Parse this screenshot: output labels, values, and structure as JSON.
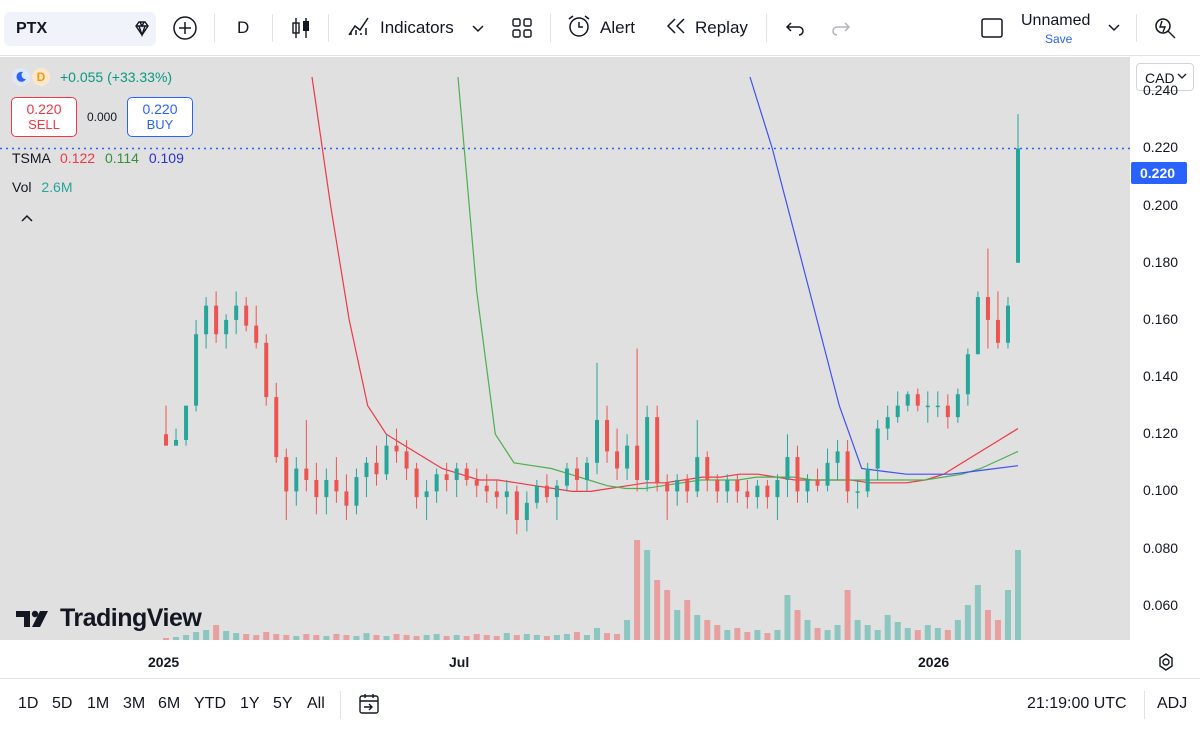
{
  "toolbar": {
    "symbol": "PTX",
    "interval": "D",
    "indicators_label": "Indicators",
    "alert_label": "Alert",
    "replay_label": "Replay",
    "layout_name": "Unnamed",
    "save_label": "Save"
  },
  "legend": {
    "session_icon": "moon-icon",
    "badge": "D",
    "change": "+0.055 (+33.33%)",
    "sell_price": "0.220",
    "sell_label": "SELL",
    "spread": "0.000",
    "buy_price": "0.220",
    "buy_label": "BUY",
    "tsma_label": "TSMA",
    "tsma_values": [
      "0.122",
      "0.114",
      "0.109"
    ],
    "vol_label": "Vol",
    "vol_value": "2.6M"
  },
  "currency": "CAD",
  "last_price_label": "0.220",
  "watermark": "TradingView",
  "bottom": {
    "ranges": [
      "1D",
      "5D",
      "1M",
      "3M",
      "6M",
      "YTD",
      "1Y",
      "5Y",
      "All"
    ],
    "time": "21:19:00 UTC",
    "adj": "ADJ"
  },
  "colors": {
    "up": "#26a69a",
    "down": "#ef5350",
    "ma_red": "#f23645",
    "ma_green": "#4caf50",
    "ma_blue": "#3f51f5",
    "price_line": "#2962ff"
  },
  "chart_data": {
    "type": "candlestick",
    "ylim": [
      0.048,
      0.252
    ],
    "y_ticks": [
      "0.240",
      "0.220",
      "0.200",
      "0.180",
      "0.160",
      "0.140",
      "0.120",
      "0.100",
      "0.080",
      "0.060"
    ],
    "x_ticks": [
      "2025",
      "Jul",
      "2026"
    ],
    "last_price": 0.22,
    "ohlc": [
      {
        "o": 0.12,
        "h": 0.13,
        "l": 0.116,
        "c": 0.116
      },
      {
        "o": 0.116,
        "h": 0.122,
        "l": 0.116,
        "c": 0.118
      },
      {
        "o": 0.118,
        "h": 0.13,
        "l": 0.116,
        "c": 0.13
      },
      {
        "o": 0.13,
        "h": 0.16,
        "l": 0.128,
        "c": 0.155
      },
      {
        "o": 0.155,
        "h": 0.168,
        "l": 0.15,
        "c": 0.165
      },
      {
        "o": 0.165,
        "h": 0.17,
        "l": 0.152,
        "c": 0.155
      },
      {
        "o": 0.155,
        "h": 0.162,
        "l": 0.15,
        "c": 0.16
      },
      {
        "o": 0.16,
        "h": 0.17,
        "l": 0.155,
        "c": 0.165
      },
      {
        "o": 0.165,
        "h": 0.168,
        "l": 0.156,
        "c": 0.158
      },
      {
        "o": 0.158,
        "h": 0.165,
        "l": 0.15,
        "c": 0.152
      },
      {
        "o": 0.152,
        "h": 0.155,
        "l": 0.13,
        "c": 0.133
      },
      {
        "o": 0.133,
        "h": 0.138,
        "l": 0.11,
        "c": 0.112
      },
      {
        "o": 0.112,
        "h": 0.115,
        "l": 0.09,
        "c": 0.1
      },
      {
        "o": 0.1,
        "h": 0.112,
        "l": 0.095,
        "c": 0.108
      },
      {
        "o": 0.108,
        "h": 0.125,
        "l": 0.1,
        "c": 0.104
      },
      {
        "o": 0.104,
        "h": 0.11,
        "l": 0.092,
        "c": 0.098
      },
      {
        "o": 0.098,
        "h": 0.108,
        "l": 0.092,
        "c": 0.104
      },
      {
        "o": 0.104,
        "h": 0.112,
        "l": 0.096,
        "c": 0.1
      },
      {
        "o": 0.1,
        "h": 0.106,
        "l": 0.09,
        "c": 0.095
      },
      {
        "o": 0.095,
        "h": 0.108,
        "l": 0.092,
        "c": 0.105
      },
      {
        "o": 0.105,
        "h": 0.112,
        "l": 0.098,
        "c": 0.11
      },
      {
        "o": 0.11,
        "h": 0.116,
        "l": 0.102,
        "c": 0.106
      },
      {
        "o": 0.106,
        "h": 0.12,
        "l": 0.104,
        "c": 0.116
      },
      {
        "o": 0.116,
        "h": 0.122,
        "l": 0.11,
        "c": 0.114
      },
      {
        "o": 0.114,
        "h": 0.118,
        "l": 0.104,
        "c": 0.108
      },
      {
        "o": 0.108,
        "h": 0.11,
        "l": 0.094,
        "c": 0.098
      },
      {
        "o": 0.098,
        "h": 0.104,
        "l": 0.09,
        "c": 0.1
      },
      {
        "o": 0.1,
        "h": 0.108,
        "l": 0.096,
        "c": 0.106
      },
      {
        "o": 0.106,
        "h": 0.11,
        "l": 0.1,
        "c": 0.104
      },
      {
        "o": 0.104,
        "h": 0.11,
        "l": 0.098,
        "c": 0.108
      },
      {
        "o": 0.108,
        "h": 0.11,
        "l": 0.102,
        "c": 0.104
      },
      {
        "o": 0.104,
        "h": 0.108,
        "l": 0.098,
        "c": 0.102
      },
      {
        "o": 0.102,
        "h": 0.106,
        "l": 0.096,
        "c": 0.1
      },
      {
        "o": 0.1,
        "h": 0.104,
        "l": 0.094,
        "c": 0.098
      },
      {
        "o": 0.098,
        "h": 0.104,
        "l": 0.092,
        "c": 0.1
      },
      {
        "o": 0.1,
        "h": 0.102,
        "l": 0.085,
        "c": 0.09
      },
      {
        "o": 0.09,
        "h": 0.1,
        "l": 0.086,
        "c": 0.096
      },
      {
        "o": 0.096,
        "h": 0.104,
        "l": 0.094,
        "c": 0.102
      },
      {
        "o": 0.102,
        "h": 0.106,
        "l": 0.096,
        "c": 0.098
      },
      {
        "o": 0.098,
        "h": 0.104,
        "l": 0.09,
        "c": 0.102
      },
      {
        "o": 0.102,
        "h": 0.11,
        "l": 0.1,
        "c": 0.108
      },
      {
        "o": 0.108,
        "h": 0.112,
        "l": 0.1,
        "c": 0.104
      },
      {
        "o": 0.104,
        "h": 0.112,
        "l": 0.1,
        "c": 0.11
      },
      {
        "o": 0.11,
        "h": 0.145,
        "l": 0.106,
        "c": 0.125
      },
      {
        "o": 0.125,
        "h": 0.13,
        "l": 0.11,
        "c": 0.114
      },
      {
        "o": 0.114,
        "h": 0.122,
        "l": 0.104,
        "c": 0.108
      },
      {
        "o": 0.108,
        "h": 0.12,
        "l": 0.104,
        "c": 0.116
      },
      {
        "o": 0.116,
        "h": 0.15,
        "l": 0.1,
        "c": 0.104
      },
      {
        "o": 0.104,
        "h": 0.13,
        "l": 0.1,
        "c": 0.126
      },
      {
        "o": 0.126,
        "h": 0.13,
        "l": 0.1,
        "c": 0.103
      },
      {
        "o": 0.103,
        "h": 0.106,
        "l": 0.09,
        "c": 0.1
      },
      {
        "o": 0.1,
        "h": 0.106,
        "l": 0.095,
        "c": 0.104
      },
      {
        "o": 0.104,
        "h": 0.106,
        "l": 0.096,
        "c": 0.1
      },
      {
        "o": 0.1,
        "h": 0.125,
        "l": 0.098,
        "c": 0.112
      },
      {
        "o": 0.112,
        "h": 0.114,
        "l": 0.1,
        "c": 0.104
      },
      {
        "o": 0.104,
        "h": 0.106,
        "l": 0.096,
        "c": 0.1
      },
      {
        "o": 0.1,
        "h": 0.106,
        "l": 0.096,
        "c": 0.104
      },
      {
        "o": 0.104,
        "h": 0.106,
        "l": 0.096,
        "c": 0.1
      },
      {
        "o": 0.1,
        "h": 0.104,
        "l": 0.094,
        "c": 0.098
      },
      {
        "o": 0.098,
        "h": 0.104,
        "l": 0.094,
        "c": 0.102
      },
      {
        "o": 0.102,
        "h": 0.104,
        "l": 0.094,
        "c": 0.098
      },
      {
        "o": 0.098,
        "h": 0.106,
        "l": 0.09,
        "c": 0.104
      },
      {
        "o": 0.104,
        "h": 0.12,
        "l": 0.098,
        "c": 0.112
      },
      {
        "o": 0.112,
        "h": 0.116,
        "l": 0.096,
        "c": 0.1
      },
      {
        "o": 0.1,
        "h": 0.106,
        "l": 0.096,
        "c": 0.104
      },
      {
        "o": 0.104,
        "h": 0.108,
        "l": 0.1,
        "c": 0.102
      },
      {
        "o": 0.102,
        "h": 0.115,
        "l": 0.1,
        "c": 0.11
      },
      {
        "o": 0.11,
        "h": 0.118,
        "l": 0.104,
        "c": 0.114
      },
      {
        "o": 0.114,
        "h": 0.118,
        "l": 0.096,
        "c": 0.1
      },
      {
        "o": 0.1,
        "h": 0.104,
        "l": 0.094,
        "c": 0.1
      },
      {
        "o": 0.1,
        "h": 0.11,
        "l": 0.098,
        "c": 0.108
      },
      {
        "o": 0.108,
        "h": 0.125,
        "l": 0.104,
        "c": 0.122
      },
      {
        "o": 0.122,
        "h": 0.13,
        "l": 0.118,
        "c": 0.126
      },
      {
        "o": 0.126,
        "h": 0.135,
        "l": 0.124,
        "c": 0.13
      },
      {
        "o": 0.13,
        "h": 0.135,
        "l": 0.128,
        "c": 0.134
      },
      {
        "o": 0.134,
        "h": 0.136,
        "l": 0.128,
        "c": 0.13
      },
      {
        "o": 0.13,
        "h": 0.135,
        "l": 0.124,
        "c": 0.13
      },
      {
        "o": 0.13,
        "h": 0.135,
        "l": 0.126,
        "c": 0.13
      },
      {
        "o": 0.13,
        "h": 0.134,
        "l": 0.122,
        "c": 0.126
      },
      {
        "o": 0.126,
        "h": 0.136,
        "l": 0.124,
        "c": 0.134
      },
      {
        "o": 0.134,
        "h": 0.15,
        "l": 0.13,
        "c": 0.148
      },
      {
        "o": 0.148,
        "h": 0.17,
        "l": 0.148,
        "c": 0.168
      },
      {
        "o": 0.168,
        "h": 0.185,
        "l": 0.15,
        "c": 0.16
      },
      {
        "o": 0.16,
        "h": 0.17,
        "l": 0.15,
        "c": 0.152
      },
      {
        "o": 0.152,
        "h": 0.168,
        "l": 0.15,
        "c": 0.165
      },
      {
        "o": 0.18,
        "h": 0.232,
        "l": 0.18,
        "c": 0.22
      }
    ],
    "volume": [
      0.02,
      0.03,
      0.05,
      0.08,
      0.1,
      0.15,
      0.09,
      0.07,
      0.06,
      0.05,
      0.08,
      0.06,
      0.05,
      0.04,
      0.06,
      0.05,
      0.04,
      0.06,
      0.05,
      0.04,
      0.07,
      0.05,
      0.04,
      0.06,
      0.05,
      0.04,
      0.05,
      0.06,
      0.04,
      0.05,
      0.04,
      0.06,
      0.05,
      0.04,
      0.07,
      0.05,
      0.06,
      0.05,
      0.04,
      0.05,
      0.06,
      0.08,
      0.05,
      0.12,
      0.07,
      0.06,
      0.2,
      1.0,
      0.9,
      0.6,
      0.5,
      0.3,
      0.4,
      0.25,
      0.2,
      0.15,
      0.1,
      0.12,
      0.08,
      0.1,
      0.07,
      0.1,
      0.45,
      0.3,
      0.2,
      0.12,
      0.1,
      0.15,
      0.5,
      0.2,
      0.15,
      0.1,
      0.25,
      0.18,
      0.12,
      0.1,
      0.15,
      0.12,
      0.1,
      0.2,
      0.35,
      0.55,
      0.3,
      0.2,
      0.5,
      0.9
    ],
    "ma_series": [
      {
        "values": [
          0.245,
          0.2,
          0.16,
          0.13,
          0.12,
          0.116,
          0.112,
          0.108,
          0.106,
          0.104,
          0.104,
          0.103,
          0.102,
          0.101,
          0.1,
          0.1,
          0.101,
          0.102,
          0.103,
          0.103,
          0.104,
          0.105,
          0.105,
          0.106,
          0.106,
          0.105,
          0.104,
          0.104,
          0.104,
          0.104,
          0.103,
          0.103,
          0.103,
          0.104,
          0.106,
          0.11,
          0.114,
          0.118,
          0.122
        ]
      },
      {
        "values": [
          0.245,
          0.17,
          0.12,
          0.11,
          0.109,
          0.108,
          0.106,
          0.104,
          0.102,
          0.101,
          0.101,
          0.102,
          0.103,
          0.104,
          0.104,
          0.104,
          0.105,
          0.105,
          0.105,
          0.104,
          0.104,
          0.104,
          0.104,
          0.104,
          0.104,
          0.104,
          0.105,
          0.106,
          0.108,
          0.111,
          0.114
        ]
      },
      {
        "values": [
          0.245,
          0.22,
          0.19,
          0.16,
          0.13,
          0.108,
          0.107,
          0.106,
          0.106,
          0.106,
          0.107,
          0.108,
          0.109
        ]
      }
    ]
  }
}
